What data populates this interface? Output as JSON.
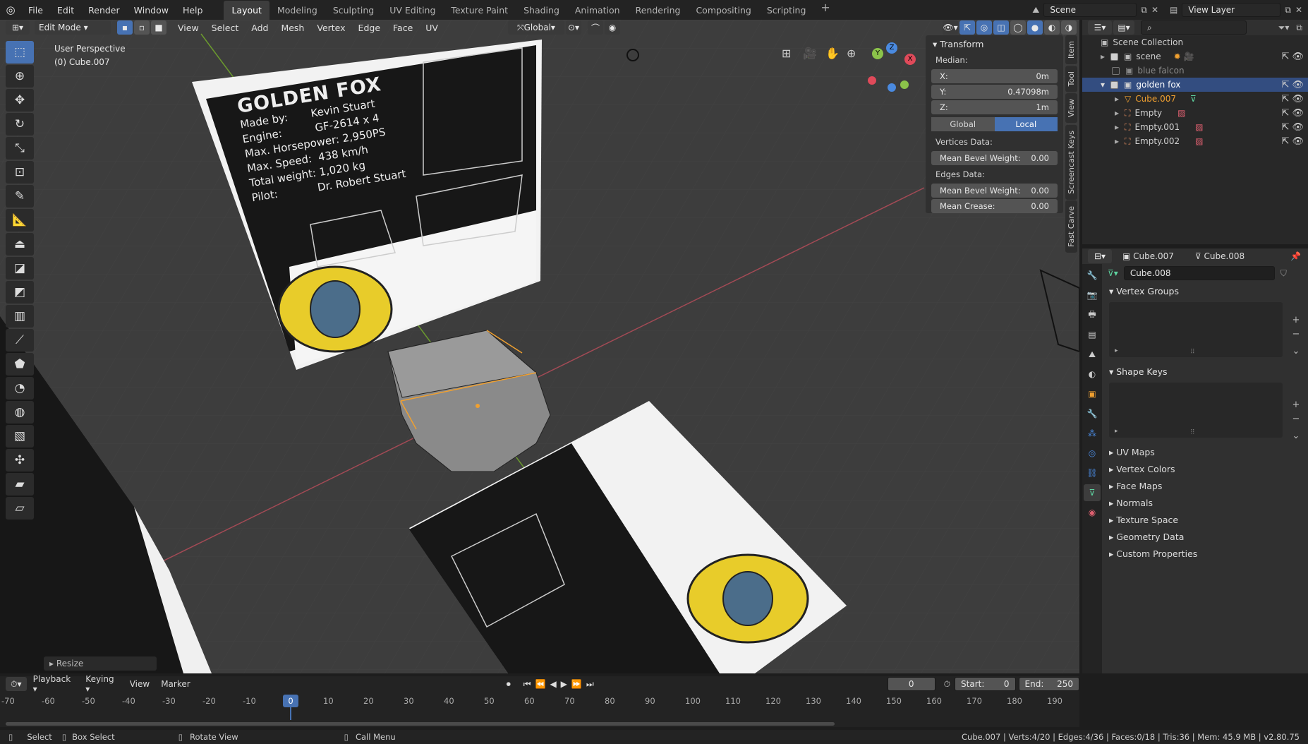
{
  "topbar": {
    "menus": [
      "File",
      "Edit",
      "Render",
      "Window",
      "Help"
    ],
    "workspaces": [
      "Layout",
      "Modeling",
      "Sculpting",
      "UV Editing",
      "Texture Paint",
      "Shading",
      "Animation",
      "Rendering",
      "Compositing",
      "Scripting"
    ],
    "active_workspace": "Layout",
    "scene": "Scene",
    "view_layer": "View Layer"
  },
  "viewport": {
    "mode": "Edit Mode",
    "menus": [
      "View",
      "Select",
      "Add",
      "Mesh",
      "Vertex",
      "Edge",
      "Face",
      "UV"
    ],
    "orientation": "Global",
    "perspective": "User Perspective",
    "object": "(0) Cube.007",
    "last_op": "Resize"
  },
  "card": {
    "title": "GOLDEN FOX",
    "lines": [
      "Made by:       Kevin Stuart",
      "Engine:          GF-2614 x 4",
      "Max. Horsepower: 2,950PS",
      "Max. Speed:  438 km/h",
      "Total weight: 1,020 kg",
      "Pilot:            Dr. Robert Stuart"
    ]
  },
  "npanel": {
    "section": "Transform",
    "median": "Median:",
    "x_label": "X:",
    "x": "0m",
    "y_label": "Y:",
    "y": "0.47098m",
    "z_label": "Z:",
    "z": "1m",
    "global": "Global",
    "local": "Local",
    "vertices_data": "Vertices Data:",
    "mean_bevel": "Mean Bevel Weight:",
    "mean_bevel_v": "0.00",
    "edges_data": "Edges Data:",
    "mean_bevel_e": "0.00",
    "mean_crease": "Mean Crease:",
    "mean_crease_v": "0.00",
    "tabs": [
      "Item",
      "Tool",
      "View",
      "Screencast Keys",
      "Fast Carve"
    ]
  },
  "outliner": {
    "root": "Scene Collection",
    "items": [
      {
        "name": "scene"
      },
      {
        "name": "blue falcon"
      },
      {
        "name": "golden fox"
      },
      {
        "name": "Cube.007"
      },
      {
        "name": "Empty"
      },
      {
        "name": "Empty.001"
      },
      {
        "name": "Empty.002"
      }
    ]
  },
  "properties": {
    "object": "Cube.007",
    "mesh": "Cube.008",
    "datablock": "Cube.008",
    "vertex_groups": "Vertex Groups",
    "shape_keys": "Shape Keys",
    "subpanels": [
      "UV Maps",
      "Vertex Colors",
      "Face Maps",
      "Normals",
      "Texture Space",
      "Geometry Data",
      "Custom Properties"
    ]
  },
  "timeline": {
    "menus": [
      "Playback",
      "Keying",
      "View",
      "Marker"
    ],
    "current": "0",
    "start_label": "Start:",
    "start": "0",
    "end_label": "End:",
    "end": "250",
    "ruler": [
      "-70",
      "-60",
      "-50",
      "-40",
      "-30",
      "-20",
      "-10",
      "0",
      "10",
      "20",
      "30",
      "40",
      "50",
      "60",
      "70",
      "80",
      "90",
      "100",
      "110",
      "120",
      "130",
      "140",
      "150",
      "160",
      "170",
      "180",
      "190"
    ]
  },
  "status": {
    "select": "Select",
    "box_select": "Box Select",
    "rotate": "Rotate View",
    "call_menu": "Call Menu",
    "info": "Cube.007 | Verts:4/20 | Edges:4/36 | Faces:0/18 | Tris:36 | Mem: 45.9 MB | v2.80.75"
  },
  "colors": {
    "accent": "#4772b3",
    "selected_orange": "#f0a030",
    "x_axis": "#e04a5a",
    "y_axis": "#8bc34a"
  }
}
